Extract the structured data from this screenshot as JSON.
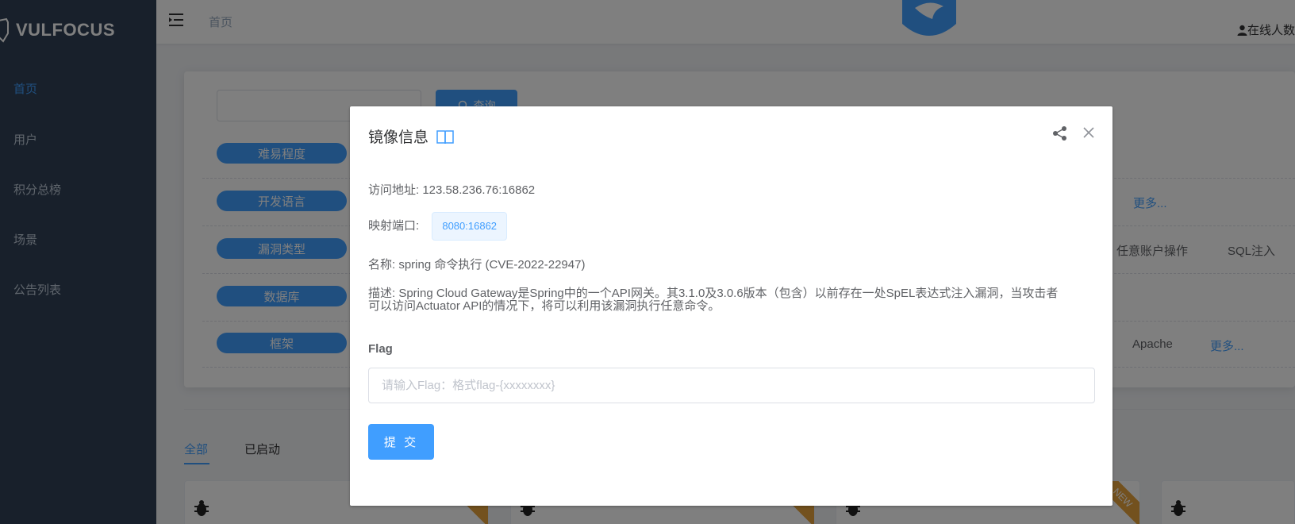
{
  "app": {
    "logo_text": "VULFOCUS"
  },
  "sidebar": {
    "items": [
      {
        "label": "首页"
      },
      {
        "label": "用户"
      },
      {
        "label": "积分总榜"
      },
      {
        "label": "场景"
      },
      {
        "label": "公告列表"
      }
    ]
  },
  "header": {
    "breadcrumb": "首页",
    "online_label": "在线人数"
  },
  "filters": {
    "search_button": "查询",
    "rows": [
      {
        "label": "难易程度"
      },
      {
        "label": "开发语言",
        "more": "更多..."
      },
      {
        "label": "漏洞类型",
        "opt1": "任意账户操作",
        "opt2": "SQL注入"
      },
      {
        "label": "数据库"
      },
      {
        "label": "框架",
        "opt1": "Apache",
        "more": "更多..."
      }
    ]
  },
  "tabs": [
    {
      "label": "全部"
    },
    {
      "label": "已启动"
    }
  ],
  "cards": {
    "ribbon": "NEW"
  },
  "dialog": {
    "title": "镜像信息",
    "address_label": "访问地址:",
    "address_value": "123.58.236.76:16862",
    "port_label": "映射端口:",
    "port_value": "8080:16862",
    "name_label": "名称:",
    "name_value": "spring 命令执行 (CVE-2022-22947)",
    "desc_line1": "描述: Spring Cloud Gateway是Spring中的一个API网关。其3.1.0及3.0.6版本（包含）以前存在一处SpEL表达式注入漏洞，当攻击者",
    "desc_line2": "可以访问Actuator API的情况下，将可以利用该漏洞执行任意命令。",
    "flag_label": "Flag",
    "flag_placeholder": "请输入Flag：格式flag-{xxxxxxxx}",
    "submit_label": "提 交"
  }
}
